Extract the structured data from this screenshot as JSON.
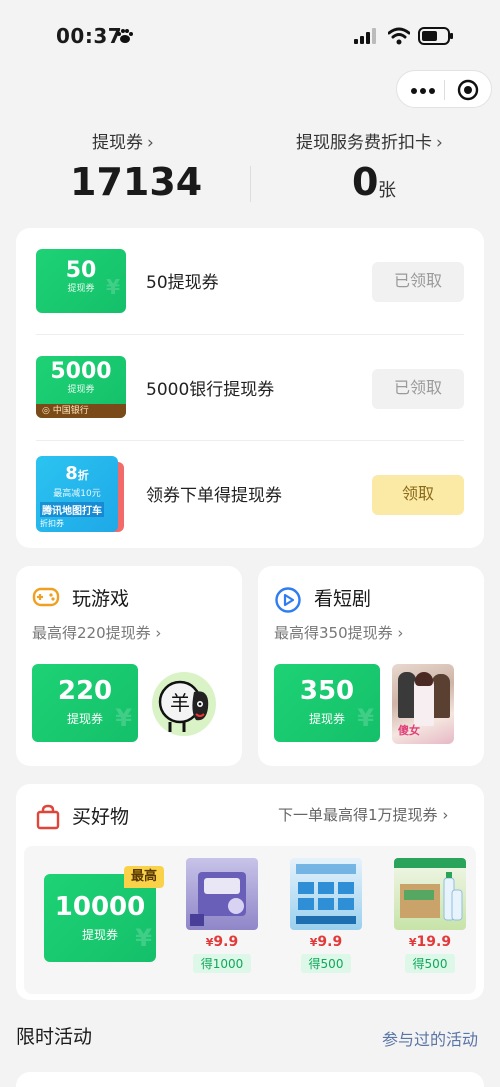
{
  "status_bar": {
    "time": "00:37",
    "icons": [
      "paw-icon",
      "signal-icon",
      "wifi-icon",
      "battery-icon"
    ]
  },
  "capsule": {
    "icons": [
      "more-dots-icon",
      "close-target-icon"
    ]
  },
  "stats": {
    "coupon_label": "提现券",
    "coupon_count": "17134",
    "card_label": "提现服务费折扣卡",
    "card_count": "0",
    "card_unit": "张",
    "chevron": "›"
  },
  "coupons": [
    {
      "thumb_value": "50",
      "thumb_sub": "提现券",
      "title": "50提现券",
      "button": "已领取",
      "state": "claimed"
    },
    {
      "thumb_value": "5000",
      "thumb_sub": "提现券",
      "thumb_bank": "中国银行",
      "title": "5000银行提现券",
      "button": "已领取",
      "state": "claimed"
    },
    {
      "thumb_value": "8",
      "thumb_pct": "折",
      "thumb_sub": "最高减10元",
      "thumb_name": "腾讯地图打车",
      "thumb_tag": "折扣券",
      "title": "领券下单得提现券",
      "button": "领取",
      "state": "available"
    }
  ],
  "game": {
    "title": "玩游戏",
    "subtitle": "最高得220提现券 ›",
    "coupon_value": "220",
    "coupon_sub": "提现券",
    "sheep_char": "羊"
  },
  "drama": {
    "title": "看短剧",
    "subtitle": "最高得350提现券 ›",
    "coupon_value": "350",
    "coupon_sub": "提现券",
    "poster_text": "傻女"
  },
  "shop": {
    "title": "买好物",
    "link": "下一单最高得1万提现券 ›",
    "coupon_value": "10000",
    "coupon_sub": "提现券",
    "badge": "最高",
    "products": [
      {
        "price": "9.9",
        "currency": "¥",
        "reward": "得1000"
      },
      {
        "price": "9.9",
        "currency": "¥",
        "reward": "得500"
      },
      {
        "price": "19.9",
        "currency": "¥",
        "reward": "得500"
      }
    ]
  },
  "limited": {
    "title": "限时活动",
    "link": "参与过的活动"
  },
  "colors": {
    "green": "#1ed275",
    "claimed_bg": "#f1f1f1",
    "claim_bg": "#fbe9a6",
    "price_red": "#e23a3a",
    "link_blue": "#5a74a6"
  }
}
